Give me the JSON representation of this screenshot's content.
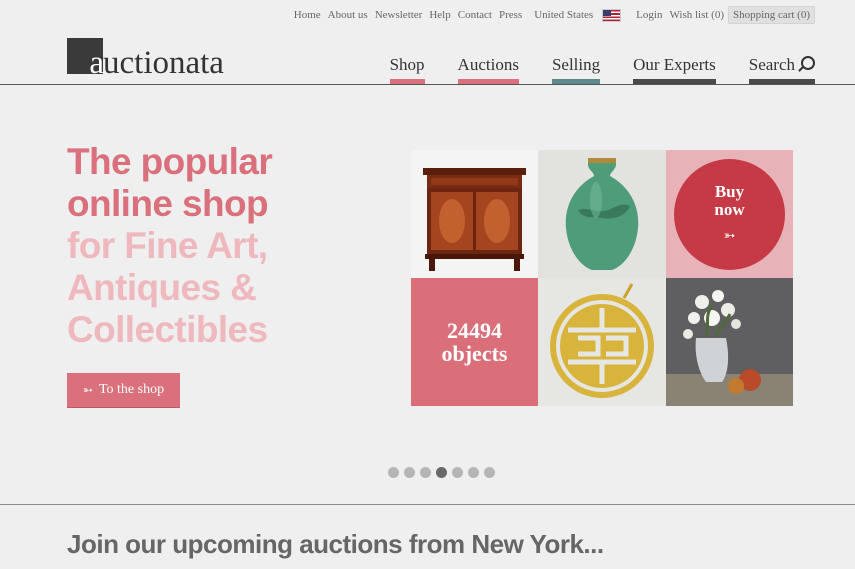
{
  "topbar": {
    "links": [
      "Home",
      "About us",
      "Newsletter",
      "Help",
      "Contact",
      "Press"
    ],
    "country": "United States",
    "flag_icon": "us-flag-icon",
    "login": "Login",
    "wishlist": "Wish list (0)",
    "cart": "Shopping cart (0)"
  },
  "logo": {
    "letter": "a",
    "rest": "uctionata"
  },
  "nav": {
    "items": [
      {
        "label": "Shop",
        "color": "#d9707b"
      },
      {
        "label": "Auctions",
        "color": "#d9707b"
      },
      {
        "label": "Selling",
        "color": "#5e8a8f"
      },
      {
        "label": "Our Experts",
        "color": "#4a4a4a"
      },
      {
        "label": "Search",
        "color": "#4a4a4a",
        "icon": "search-icon"
      }
    ]
  },
  "hero": {
    "line1": "The popular",
    "line2": "online shop",
    "line3": "for Fine Art,",
    "line4": "Antiques &",
    "line5": "Collectibles",
    "button_label": "To the shop",
    "button_icon": "arrow-right-icon"
  },
  "tiles": {
    "buy_line1": "Buy",
    "buy_line2": "now",
    "count_number": "24494",
    "count_label": "objects"
  },
  "carousel": {
    "total": 7,
    "active": 3
  },
  "section": {
    "title": "Join our upcoming auctions from New York..."
  },
  "colors": {
    "accent": "#d9707b",
    "accent_light": "#efb8bd",
    "buy_red": "#c53a45"
  }
}
